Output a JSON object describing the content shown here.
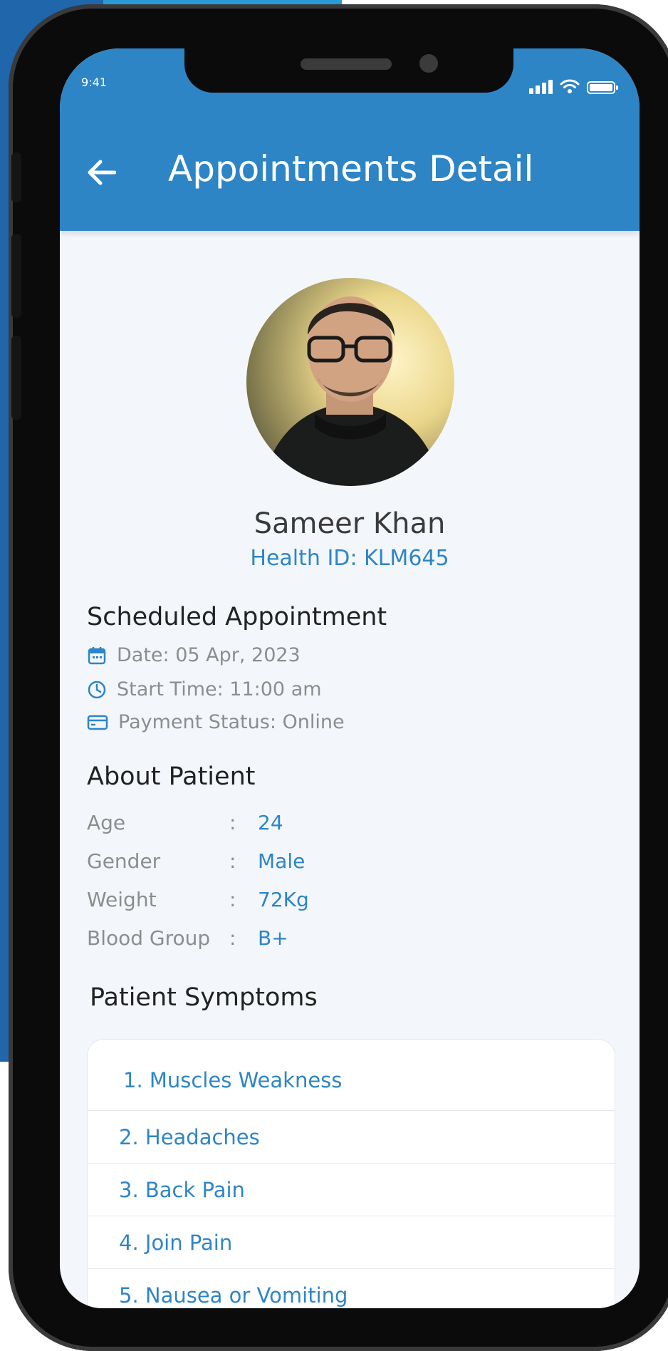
{
  "status_bar": {
    "time": "9:41"
  },
  "header": {
    "title": "Appointments Detail",
    "back_icon": "arrow-left-icon"
  },
  "patient": {
    "name": "Sameer Khan",
    "health_id": "Health ID: KLM645"
  },
  "scheduled": {
    "heading": "Scheduled Appointment",
    "date": "Date: 05 Apr, 2023",
    "start_time": "Start Time: 11:00 am",
    "payment": "Payment Status: Online"
  },
  "about": {
    "heading": "About Patient",
    "rows": [
      {
        "label": "Age",
        "sep": ":",
        "value": "24"
      },
      {
        "label": "Gender",
        "sep": ":",
        "value": "Male"
      },
      {
        "label": "Weight",
        "sep": ":",
        "value": "72Kg"
      },
      {
        "label": "Blood Group",
        "sep": ":",
        "value": "B+"
      }
    ]
  },
  "symptoms": {
    "heading": "Patient Symptoms",
    "items": [
      "1. Muscles Weakness",
      "2. Headaches",
      "3. Back Pain",
      "4. Join Pain",
      "5. Nausea or Vomiting"
    ]
  },
  "colors": {
    "primary": "#2e85c6",
    "background": "#f3f7fc"
  }
}
